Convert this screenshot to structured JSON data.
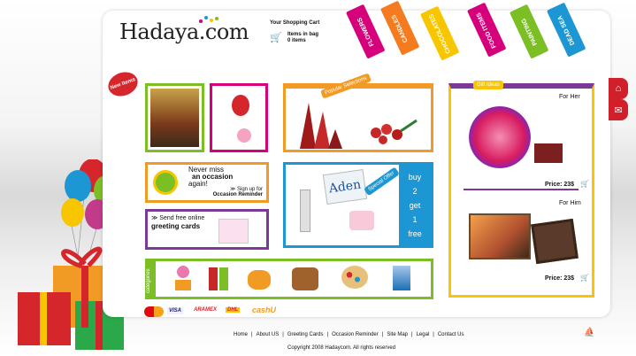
{
  "logo": {
    "text": "Hadaya.com"
  },
  "cart": {
    "title": "Your Shopping Cart",
    "line1": "Items in bag",
    "line2": "0 items"
  },
  "ribbons": [
    {
      "label": "FLOWERS",
      "color": "#d5007a"
    },
    {
      "label": "CANDLES",
      "color": "#f47b20"
    },
    {
      "label": "CHOCOLATES",
      "color": "#f7c600"
    },
    {
      "label": "FOOD ITEMS",
      "color": "#d5007a"
    },
    {
      "label": "PAINTING",
      "color": "#7bbf25"
    },
    {
      "label": "DEAD SEA",
      "color": "#1c97d4"
    }
  ],
  "new_items": {
    "label": "New Items"
  },
  "popular": {
    "label": "Popular Selections"
  },
  "gift_ideas": {
    "label": "Gift Ideas",
    "for_her": "For Her",
    "for_him": "For Him",
    "price_her": "Price: 23$",
    "price_him": "Price: 23$"
  },
  "reminder": {
    "line1": "Never miss",
    "line2": "an occasion",
    "line3": "again!",
    "link_prefix": "≫ Sign up for",
    "link": "Occasion Reminder"
  },
  "greeting": {
    "line1": "≫ Send free online",
    "line2": "greeting cards"
  },
  "special": {
    "tag": "Special Offer",
    "brand": "Aden",
    "buy": "buy",
    "n1": "2",
    "get": "get",
    "n2": "1",
    "free": "free"
  },
  "categories": {
    "label": "categories"
  },
  "payments": [
    "VISA",
    "ARAMEX",
    "DHL",
    "cashU"
  ],
  "footer": {
    "links": [
      "Home",
      "About US",
      "Greeting Cards",
      "Occasion Reminder",
      "Site Map",
      "Legal",
      "Contact Us"
    ],
    "copyright": "Copyright 2008 Hadaycom. All rights reserved"
  },
  "colors": {
    "green": "#7bbf25",
    "magenta": "#d5007a",
    "orange": "#f29b24",
    "blue": "#1c97d4",
    "purple": "#7b3a96",
    "red": "#d1202a"
  }
}
